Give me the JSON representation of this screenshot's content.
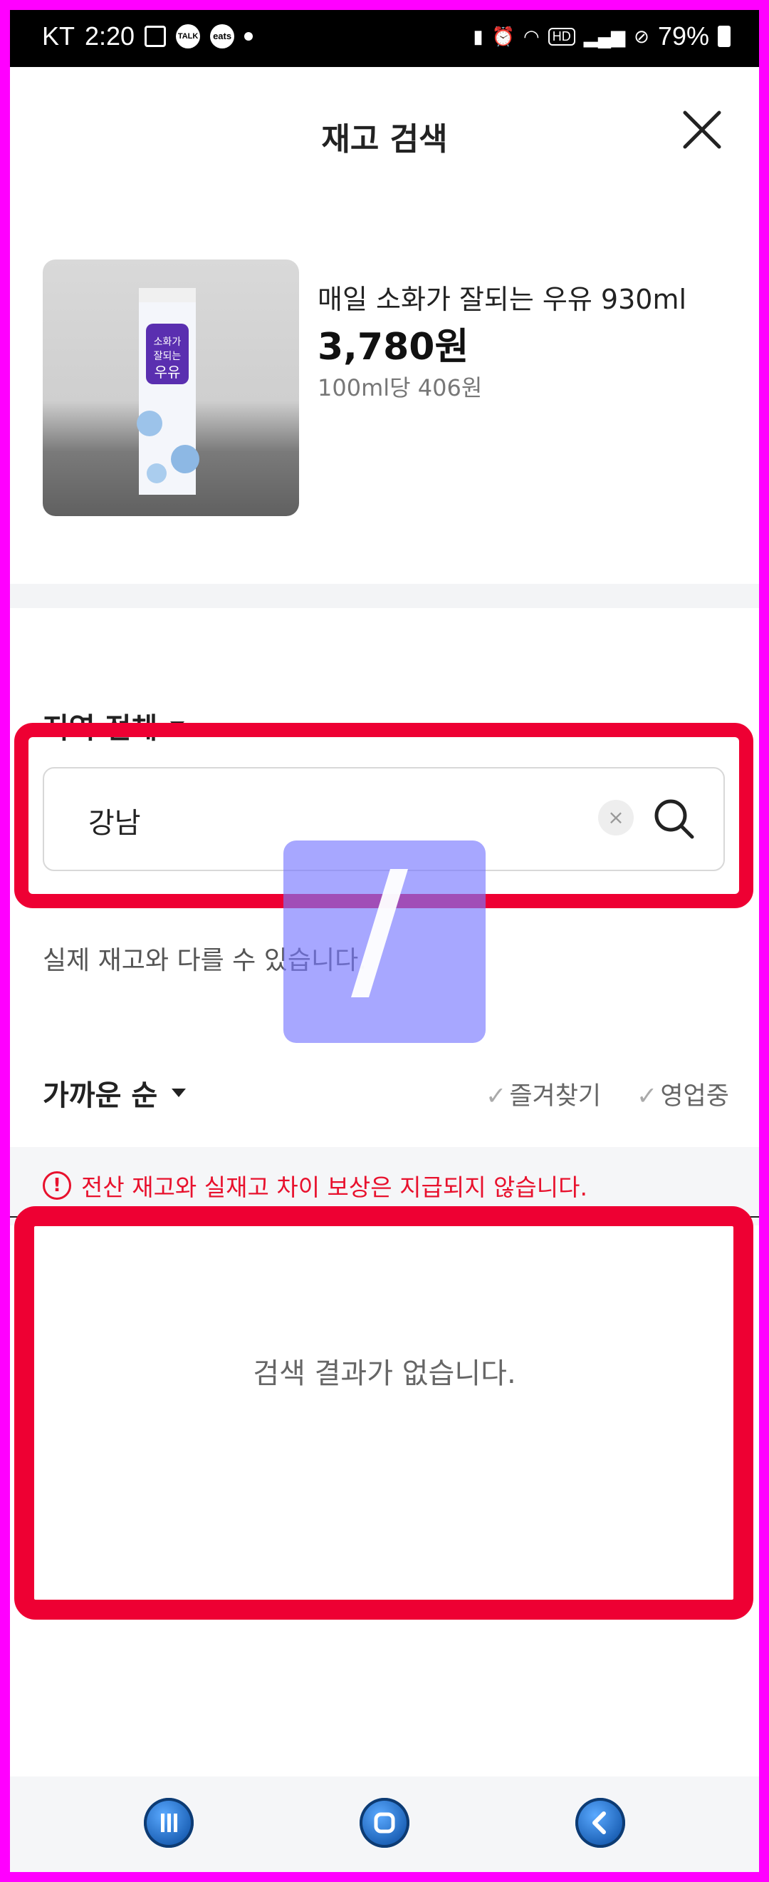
{
  "status_bar": {
    "carrier": "KT",
    "time": "2:20",
    "talk_badge": "TALK",
    "eats_badge": "eats",
    "hd_label": "HD",
    "battery": "79%"
  },
  "header": {
    "title": "재고 검색"
  },
  "product": {
    "image_label": "소화가 잘되는 우유",
    "name": "매일 소화가 잘되는 우유 930ml",
    "price": "3,780원",
    "unit_price": "100ml당 406원"
  },
  "region": {
    "label": "지역 전체"
  },
  "search": {
    "value": "강남",
    "placeholder": ""
  },
  "notice": {
    "line2": "실제 재고와 다를 수 있습니다."
  },
  "sort": {
    "label": "가까운 순"
  },
  "filters": {
    "favorites": "즐겨찾기",
    "open": "영업중"
  },
  "warning": {
    "icon": "!",
    "text": "전산 재고와 실재고 차이 보상은 지급되지 않습니다."
  },
  "results": {
    "empty": "검색 결과가 없습니다."
  },
  "colors": {
    "highlight": "#ee0033",
    "warning": "#e8112d",
    "overlay": "#7878ff"
  }
}
